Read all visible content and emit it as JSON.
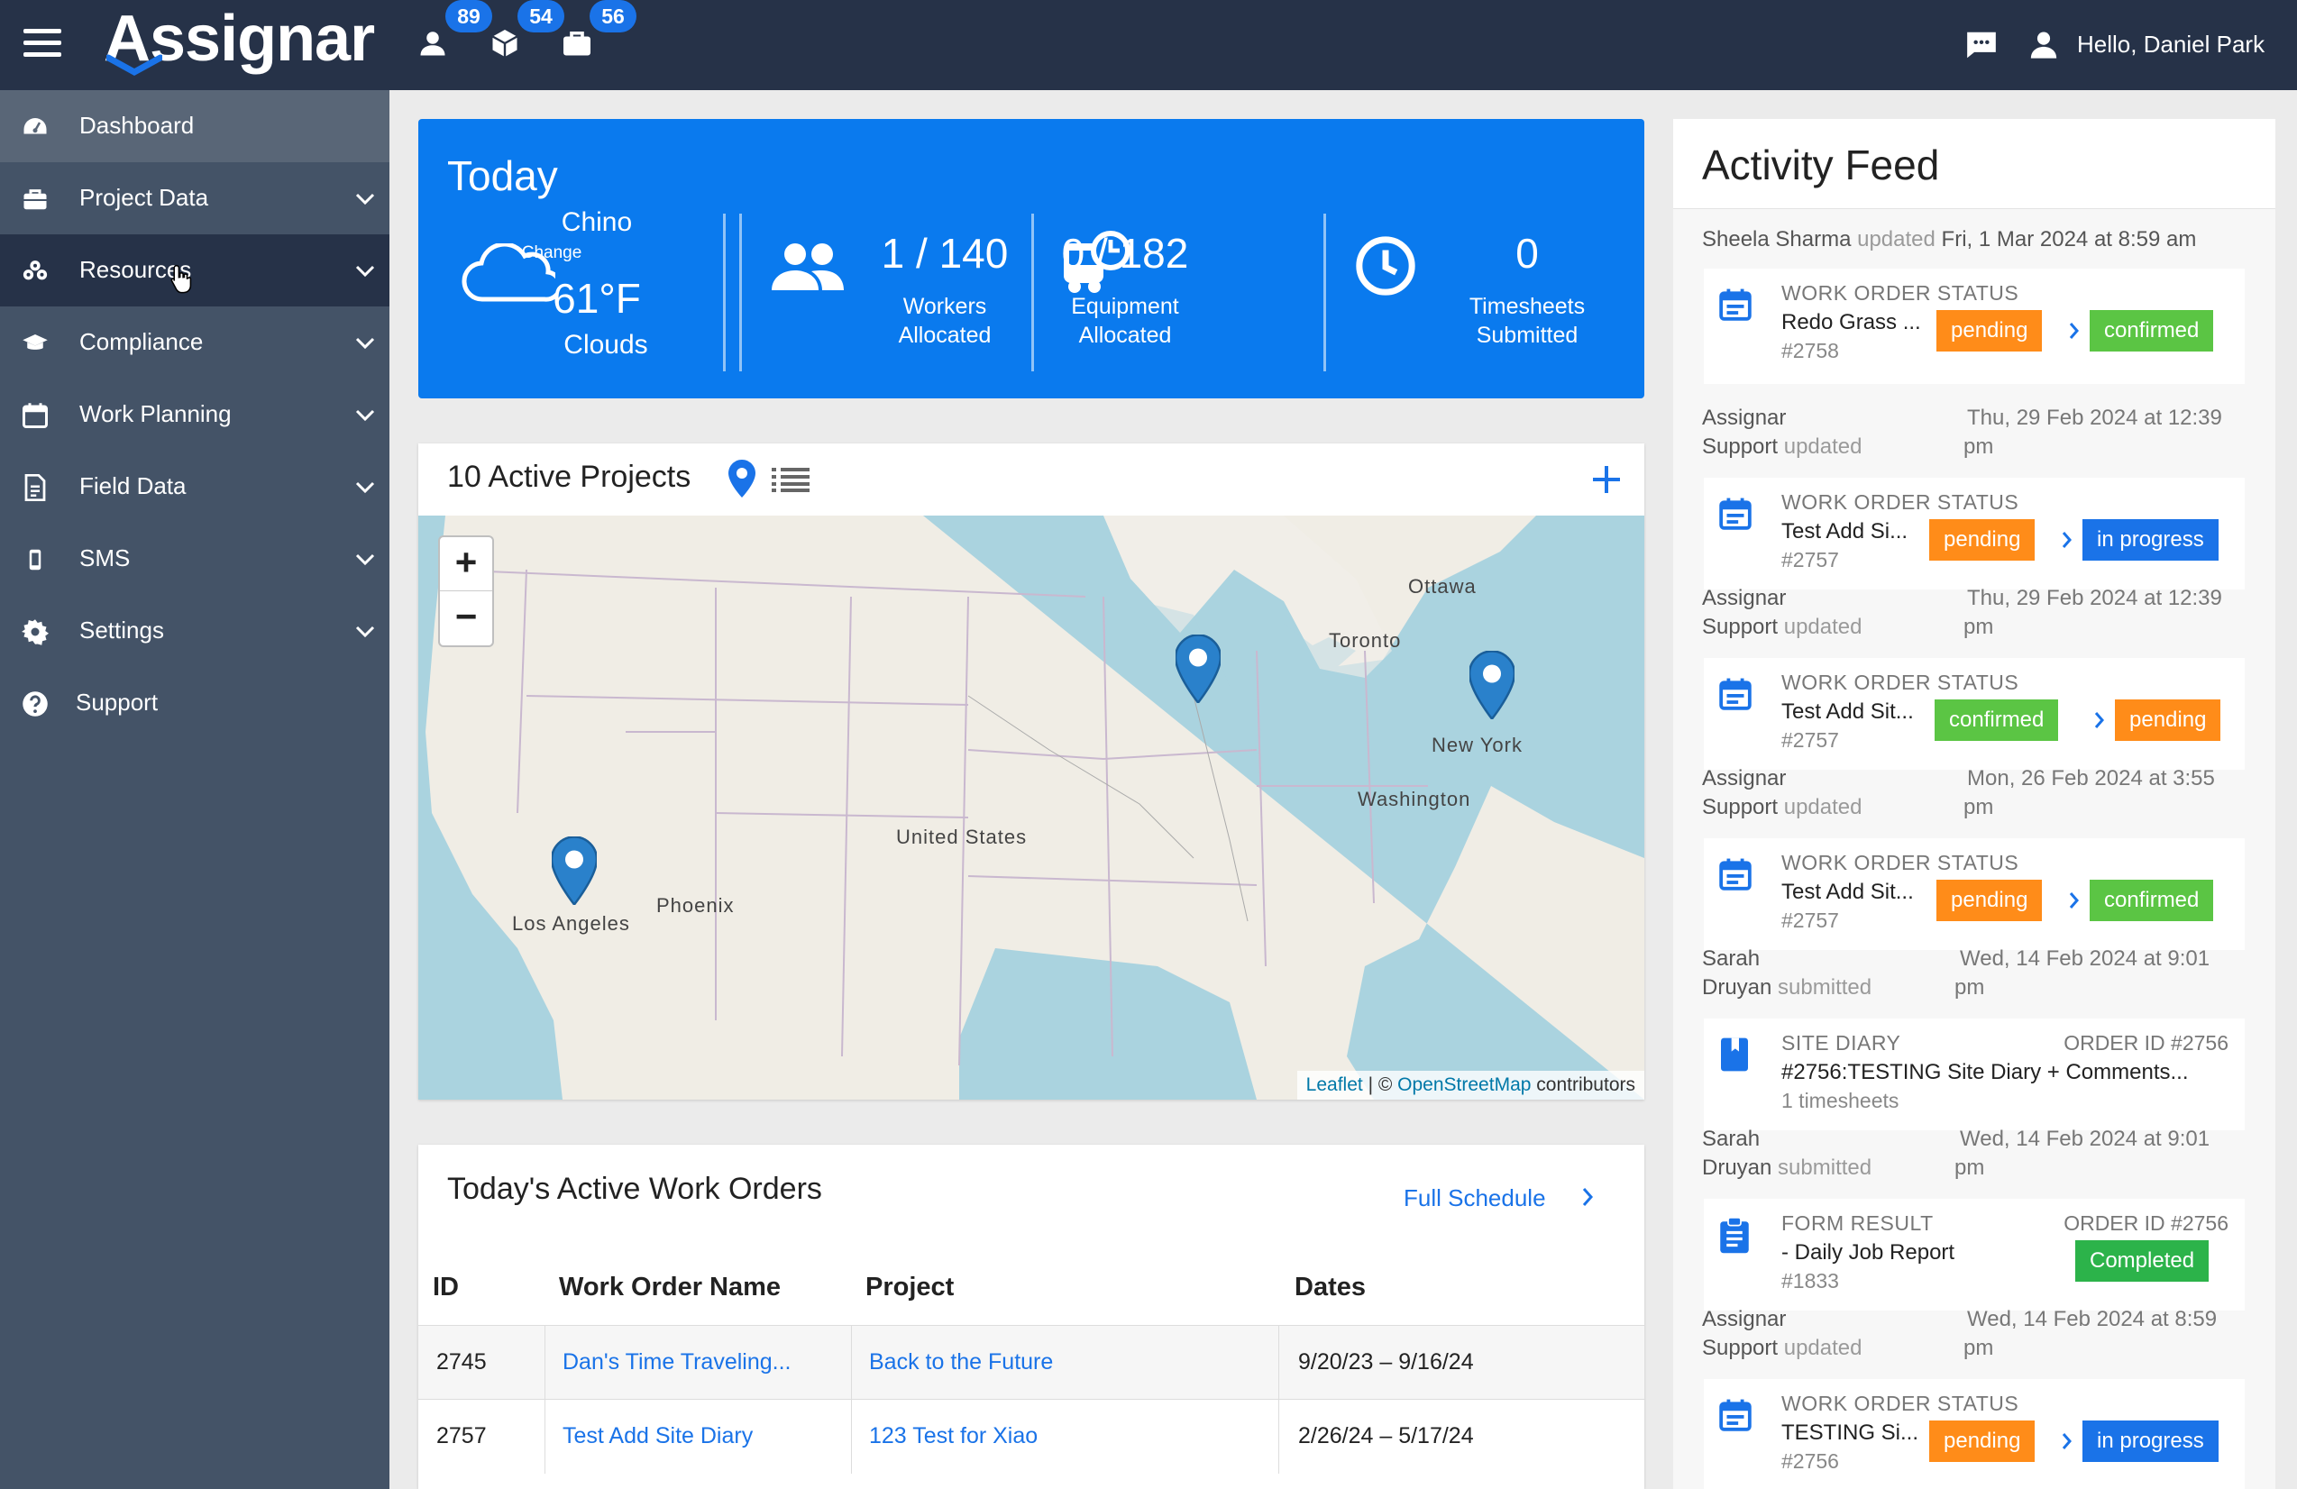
{
  "app": {
    "logo": "Assignar",
    "greeting": "Hello, Daniel Park",
    "badges": {
      "users": "89",
      "equipment": "54",
      "projects": "56"
    }
  },
  "sidebar": {
    "items": [
      {
        "label": "Dashboard",
        "icon": "dashboard-icon"
      },
      {
        "label": "Project Data",
        "icon": "briefcase-icon"
      },
      {
        "label": "Resources",
        "icon": "resources-icon"
      },
      {
        "label": "Compliance",
        "icon": "graduation-cap-icon"
      },
      {
        "label": "Work Planning",
        "icon": "calendar-icon"
      },
      {
        "label": "Field Data",
        "icon": "document-icon"
      },
      {
        "label": "SMS",
        "icon": "phone-icon"
      },
      {
        "label": "Settings",
        "icon": "gear-icon"
      },
      {
        "label": "Support",
        "icon": "help-icon"
      }
    ]
  },
  "today": {
    "title": "Today",
    "weather": {
      "city": "Chino",
      "change": "Change",
      "temp": "61°F",
      "cond": "Clouds"
    },
    "workers": {
      "value": "1 / 140",
      "label_1": "Workers",
      "label_2": "Allocated"
    },
    "equipment": {
      "value": "0 / 182",
      "label_1": "Equipment",
      "label_2": "Allocated"
    },
    "timesheets": {
      "value": "0",
      "label_1": "Timesheets",
      "label_2": "Submitted"
    }
  },
  "projects": {
    "title": "10 Active Projects",
    "map_labels": {
      "ottawa": "Ottawa",
      "toronto": "Toronto",
      "new_york": "New York",
      "washington": "Washington",
      "united_states": "United States",
      "phoenix": "Phoenix",
      "los_angeles": "Los Angeles"
    },
    "attribution": {
      "leaflet": "Leaflet",
      "sep": " | © ",
      "osm": "OpenStreetMap",
      "contrib": " contributors"
    }
  },
  "work_orders": {
    "title": "Today's Active Work Orders",
    "full_schedule": "Full Schedule",
    "columns": [
      "ID",
      "Work Order Name",
      "Project",
      "Dates"
    ],
    "rows": [
      {
        "id": "2745",
        "name": "Dan's Time Traveling...",
        "project": "Back to the Future",
        "dates": "9/20/23 – 9/16/24"
      },
      {
        "id": "2757",
        "name": "Test Add Site Diary",
        "project": "123 Test for Xiao",
        "dates": "2/26/24 – 5/17/24"
      }
    ]
  },
  "feed": {
    "title": "Activity Feed",
    "entries": [
      {
        "who": "Sheela Sharma",
        "verb": "updated",
        "date": "Fri, 1 Mar 2024 at 8:59 am",
        "kind": "WORK ORDER STATUS",
        "name": "Redo Grass ...",
        "num": "#2758",
        "from": "pending",
        "to": "confirmed"
      },
      {
        "who_1": "Assignar",
        "who_2": "Support",
        "verb": "updated",
        "date_1": "Thu, 29 Feb 2024 at 12:39",
        "date_2": "pm",
        "kind": "WORK ORDER STATUS",
        "name": "Test Add Si...",
        "num": "#2757",
        "from": "pending",
        "to": "in progress"
      },
      {
        "who_1": "Assignar",
        "who_2": "Support",
        "verb": "updated",
        "date_1": "Thu, 29 Feb 2024 at 12:39",
        "date_2": "pm",
        "kind": "WORK ORDER STATUS",
        "name": "Test Add Sit...",
        "num": "#2757",
        "from": "confirmed",
        "to": "pending"
      },
      {
        "who_1": "Assignar",
        "who_2": "Support",
        "verb": "updated",
        "date_1": "Mon, 26 Feb 2024 at 3:55",
        "date_2": "pm",
        "kind": "WORK ORDER STATUS",
        "name": "Test Add Sit...",
        "num": "#2757",
        "from": "pending",
        "to": "confirmed"
      },
      {
        "who_1": "Sarah",
        "who_2": "Druyan",
        "verb": "submitted",
        "date_1": "Wed, 14 Feb 2024 at 9:01",
        "date_2": "pm",
        "kind": "SITE DIARY",
        "order": "ORDER ID #2756",
        "name": "#2756:TESTING Site Diary + Comments...",
        "num": "1 timesheets"
      },
      {
        "who_1": "Sarah",
        "who_2": "Druyan",
        "verb": "submitted",
        "date_1": "Wed, 14 Feb 2024 at 9:01",
        "date_2": "pm",
        "kind": "FORM RESULT",
        "order": "ORDER ID #2756",
        "name": "- Daily Job Report",
        "num": "#1833",
        "status": "Completed"
      },
      {
        "who_1": "Assignar",
        "who_2": "Support",
        "verb": "updated",
        "date_1": "Wed, 14 Feb 2024 at 8:59",
        "date_2": "pm",
        "kind": "WORK ORDER STATUS",
        "name": "TESTING Si...",
        "num": "#2756",
        "from": "pending",
        "to": "in progress"
      }
    ]
  },
  "colors": {
    "sidebar": "#445367",
    "topbar": "#263248",
    "accent": "#1a73e8",
    "pending": "#ff8c19",
    "confirmed": "#5bc544"
  }
}
